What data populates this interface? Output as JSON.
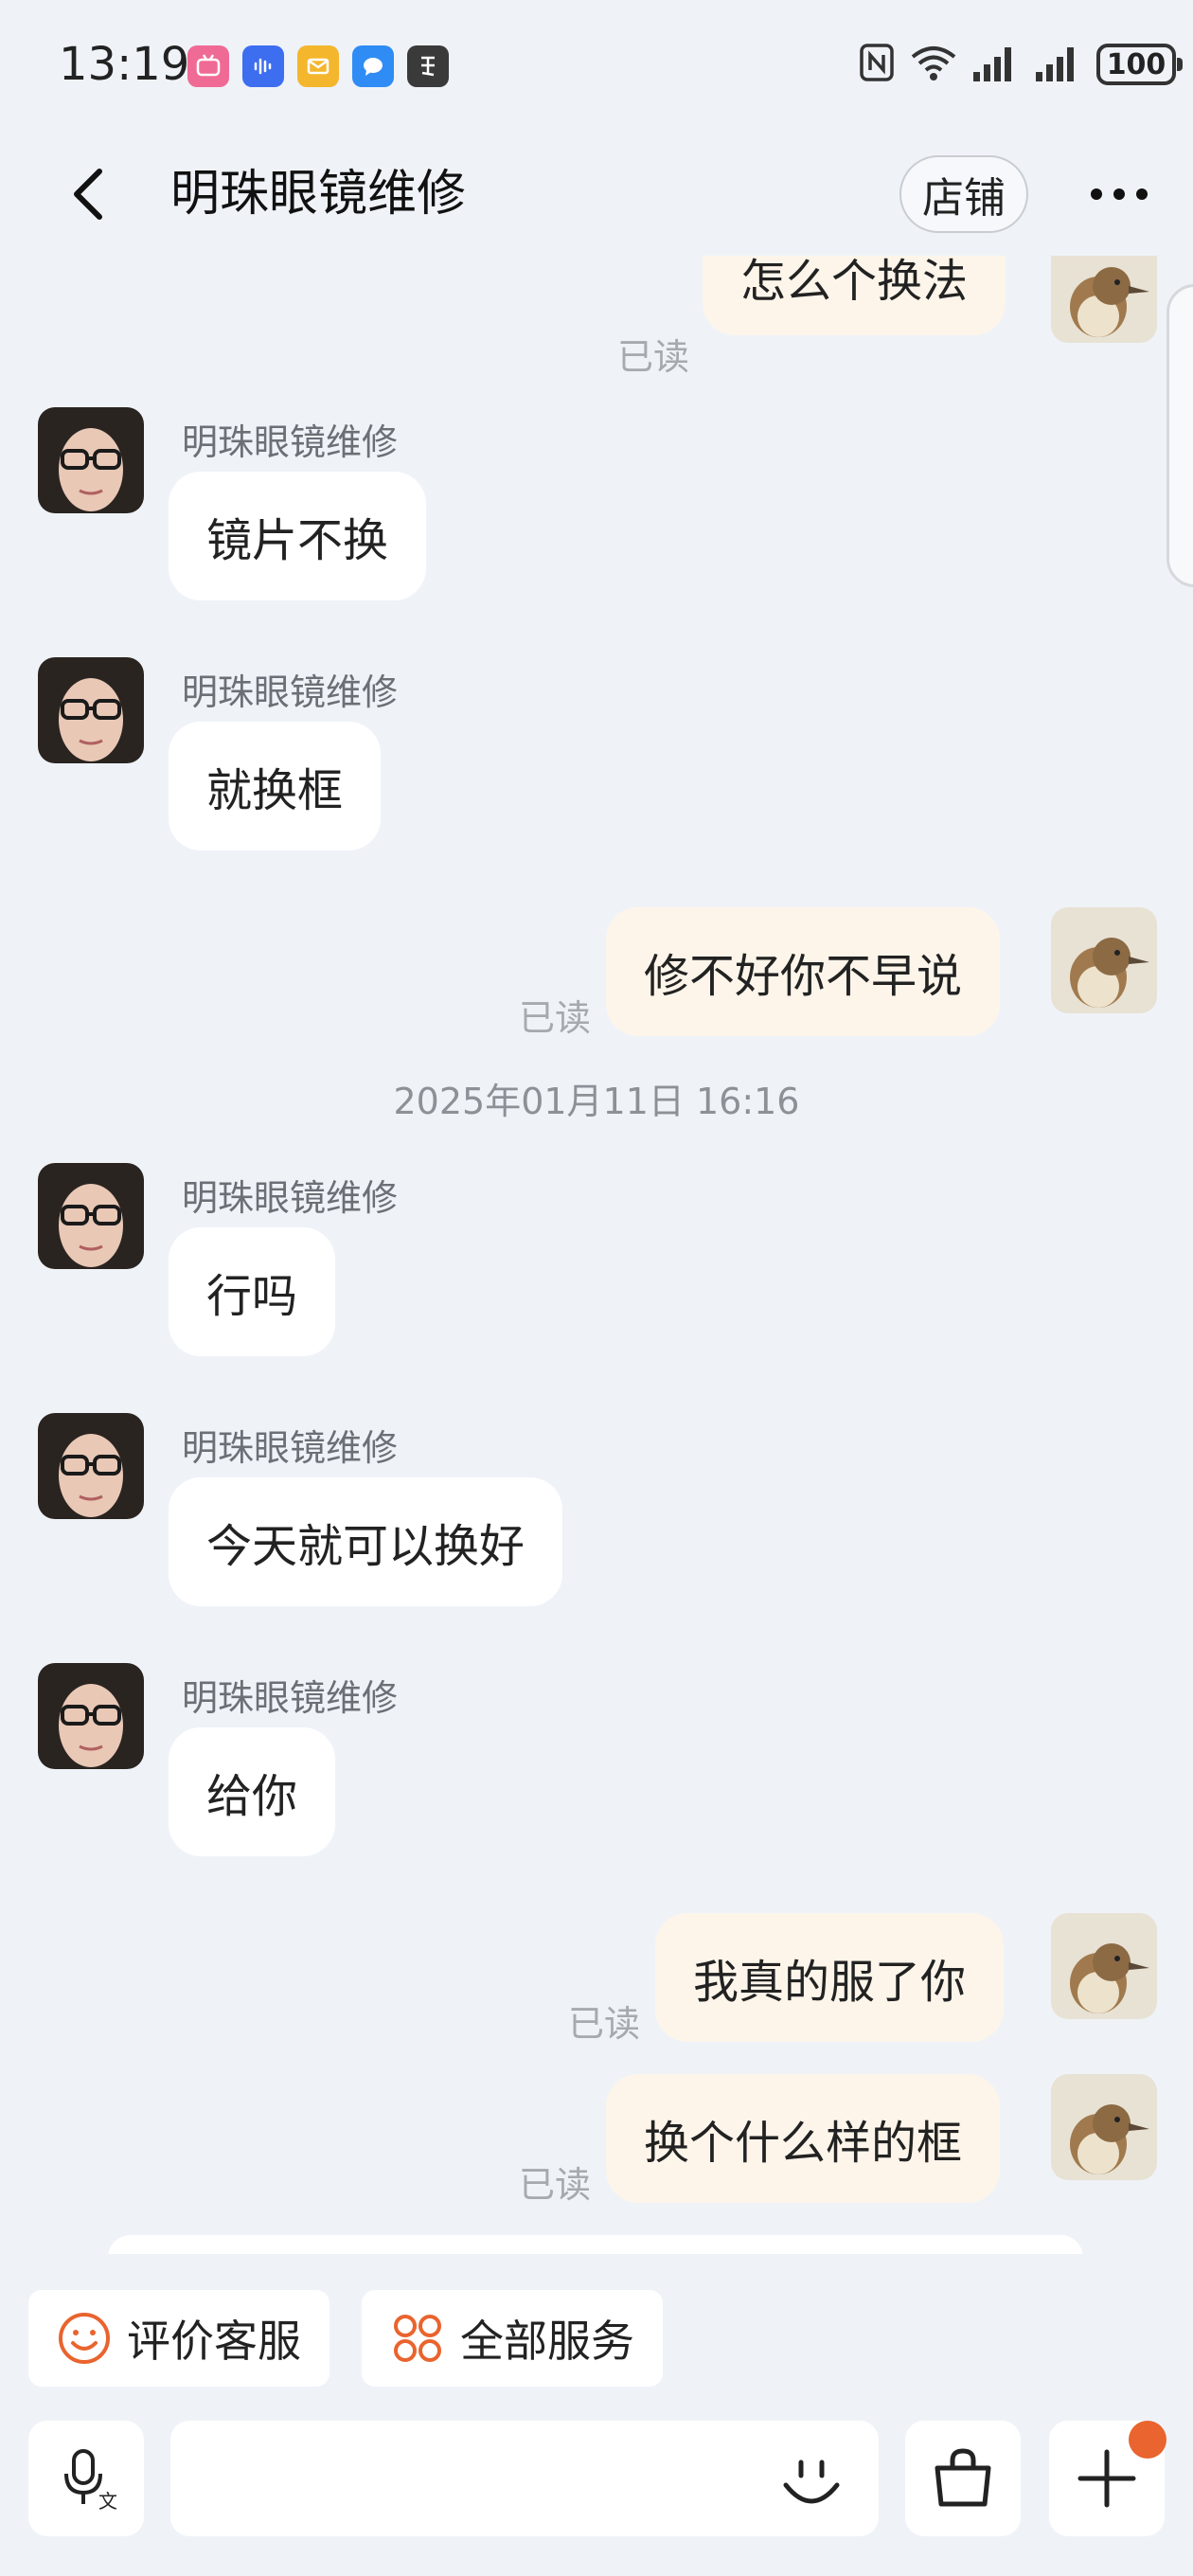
{
  "status_bar": {
    "time": "13:19",
    "battery": "100",
    "app_icons": [
      "bilibili-icon",
      "voice-recorder-icon",
      "mail-icon",
      "messaging-icon",
      "calligraphy-app-icon"
    ]
  },
  "header": {
    "title": "明珠眼镜维修",
    "shop_label": "店铺"
  },
  "colors": {
    "background": "#eff3f8",
    "incoming_bubble": "#ffffff",
    "outgoing_bubble": "#fdf5ea",
    "accent_orange": "#e9642e",
    "read_text": "#a6a9ae"
  },
  "messages": [
    {
      "direction": "out",
      "text": "怎么个换法",
      "status": "已读"
    },
    {
      "direction": "in",
      "sender": "明珠眼镜维修",
      "text": "镜片不换"
    },
    {
      "direction": "in",
      "sender": "明珠眼镜维修",
      "text": "就换框"
    },
    {
      "direction": "out",
      "text": "修不好你不早说",
      "status": "已读"
    },
    {
      "type": "timestamp",
      "text": "2025年01月11日 16:16"
    },
    {
      "direction": "in",
      "sender": "明珠眼镜维修",
      "text": "行吗"
    },
    {
      "direction": "in",
      "sender": "明珠眼镜维修",
      "text": "今天就可以换好"
    },
    {
      "direction": "in",
      "sender": "明珠眼镜维修",
      "text": "给你"
    },
    {
      "direction": "out",
      "text": "我真的服了你",
      "status": "已读"
    },
    {
      "direction": "out",
      "text": "换个什么样的框",
      "status": "已读"
    }
  ],
  "quick_actions": [
    {
      "label": "评价客服",
      "icon": "smile-icon"
    },
    {
      "label": "全部服务",
      "icon": "grid-icon"
    }
  ],
  "input": {
    "placeholder": ""
  }
}
